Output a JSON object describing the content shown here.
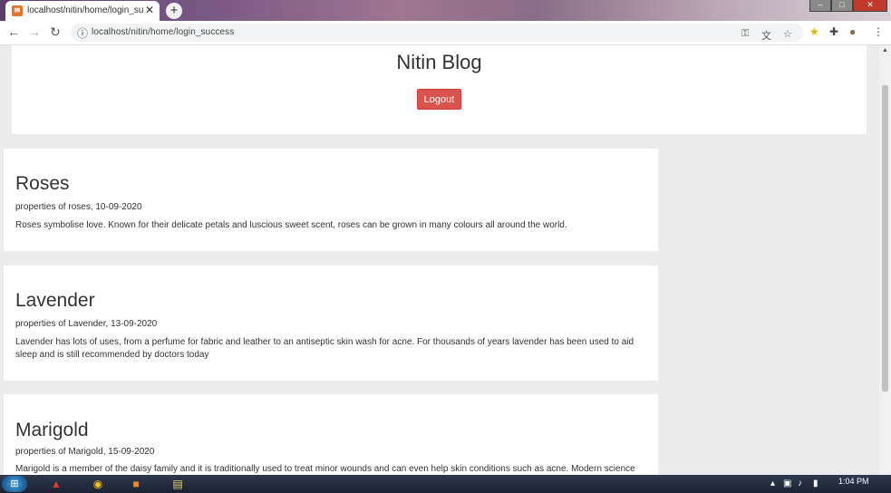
{
  "browser": {
    "tab_title": "localhost/nitin/home/login_succe",
    "tab_close": "✕",
    "new_tab": "+",
    "url": "localhost/nitin/home/login_success",
    "window_controls": {
      "minimize": "–",
      "maximize": "□",
      "close": "✕"
    }
  },
  "page": {
    "blog_title": "Nitin Blog",
    "logout_label": "Logout",
    "posts": [
      {
        "title": "Roses",
        "meta": "properties of roses, 10-09-2020",
        "body": "Roses symbolise love. Known for their delicate petals and luscious sweet scent, roses can be grown in many colours all around the world."
      },
      {
        "title": "Lavender",
        "meta": "properties of Lavender, 13-09-2020",
        "body": "Lavender has lots of uses, from a perfume for fabric and leather to an antiseptic skin wash for acne. For thousands of years lavender has been used to aid sleep and is still recommended by doctors today"
      },
      {
        "title": "Marigold",
        "meta": "properties of Marigold, 15-09-2020",
        "body": "Marigold is a member of the daisy family and it is traditionally used to treat minor wounds and can even help skin conditions such as acne. Modern science"
      }
    ]
  },
  "taskbar": {
    "clock_time": "1:04 PM"
  },
  "colors": {
    "logout_bg": "#d9534f",
    "page_bg": "#ececec"
  }
}
